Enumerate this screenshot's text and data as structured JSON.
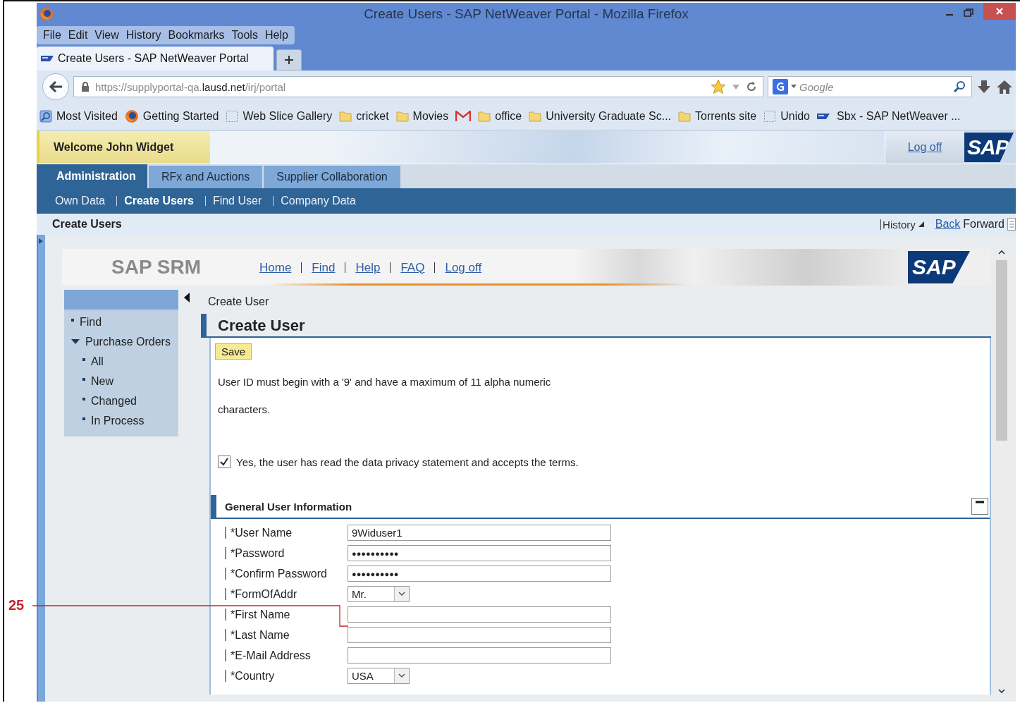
{
  "callout": {
    "label": "25"
  },
  "window": {
    "title": "Create Users - SAP NetWeaver Portal - Mozilla Firefox"
  },
  "menu": [
    "File",
    "Edit",
    "View",
    "History",
    "Bookmarks",
    "Tools",
    "Help"
  ],
  "tabs": [
    {
      "label": "Create Users - SAP NetWeaver Portal",
      "selected": true
    }
  ],
  "address_bar": {
    "url": "https://supplyportal-qa.**lausd.net**/irj/portal"
  },
  "search": {
    "placeholder": "Google"
  },
  "bookmarks": [
    {
      "kind": "most-visited",
      "label": "Most Visited"
    },
    {
      "kind": "firefox",
      "label": "Getting Started"
    },
    {
      "kind": "page",
      "label": "Web Slice Gallery"
    },
    {
      "kind": "folder",
      "label": "cricket"
    },
    {
      "kind": "folder",
      "label": "Movies"
    },
    {
      "kind": "gmail"
    },
    {
      "kind": "folder",
      "label": "office"
    },
    {
      "kind": "folder",
      "label": "University Graduate Sc..."
    },
    {
      "kind": "folder",
      "label": "Torrents site"
    },
    {
      "kind": "page",
      "label": "Unido"
    },
    {
      "kind": "sap",
      "label": "Sbx - SAP NetWeaver ..."
    }
  ],
  "portal": {
    "welcome": "Welcome John Widget",
    "log_off": "Log off",
    "logo": "SAP",
    "tabs": [
      {
        "label": "Administration",
        "selected": true
      },
      {
        "label": "RFx and Auctions",
        "selected": false
      },
      {
        "label": "Supplier Collaboration",
        "selected": false
      }
    ],
    "subnav": [
      {
        "label": "Own Data",
        "selected": false
      },
      {
        "label": "Create Users",
        "selected": true
      },
      {
        "label": "Find User",
        "selected": false
      },
      {
        "label": "Company Data",
        "selected": false
      }
    ],
    "page_title": "Create Users",
    "history": "History",
    "back": "Back",
    "forward": "Forward"
  },
  "srm": {
    "title": "SAP SRM",
    "links": [
      "Home",
      "Find",
      "Help",
      "FAQ",
      "Log off"
    ],
    "logo": "SAP",
    "sidebar": [
      {
        "label": "Find"
      },
      {
        "label": "Purchase Orders",
        "expanded": true,
        "children": [
          {
            "label": "All"
          },
          {
            "label": "New"
          },
          {
            "label": "Changed"
          },
          {
            "label": "In Process"
          }
        ]
      }
    ],
    "breadcrumb": "Create User"
  },
  "form": {
    "title": "Create User",
    "save": "Save",
    "note": "User ID must begin with a '9' and have a maximum of 11 alpha numeric characters.",
    "privacy": {
      "label": "Yes, the user has read the data privacy statement and accepts the terms.",
      "checked": true
    },
    "section": {
      "title": "General User Information",
      "expanded": true
    },
    "fields": [
      {
        "label": "*User Name",
        "kind": "text",
        "value": "9Widuser1"
      },
      {
        "label": "*Password",
        "kind": "password",
        "value": "●●●●●●●●●●"
      },
      {
        "label": "*Confirm Password",
        "kind": "password",
        "value": "●●●●●●●●●●"
      },
      {
        "label": "*FormOfAddr",
        "kind": "select",
        "value": "Mr."
      },
      {
        "label": "*First Name",
        "kind": "text"
      },
      {
        "label": "*Last Name",
        "kind": "text"
      },
      {
        "label": "*E-Mail Address",
        "kind": "text"
      },
      {
        "label": "*Country",
        "kind": "select",
        "value": "USA"
      }
    ]
  }
}
